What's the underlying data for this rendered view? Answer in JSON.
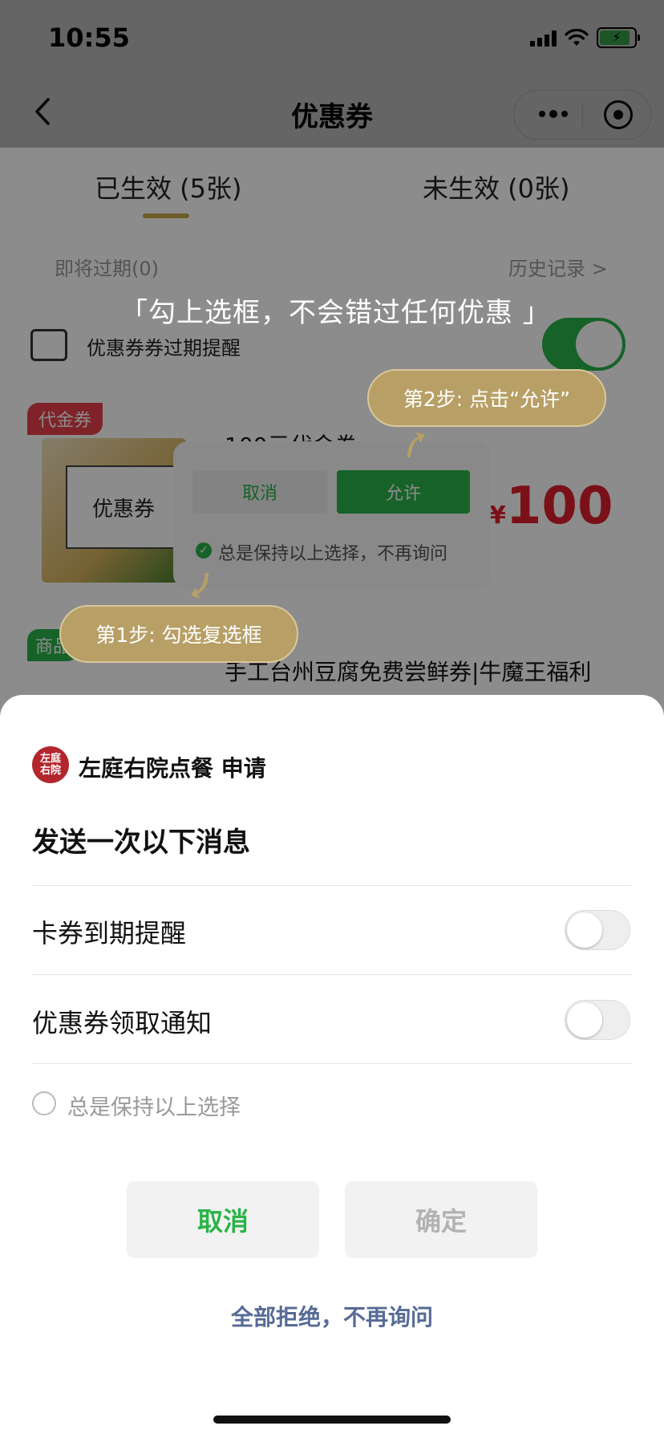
{
  "status_bar": {
    "time": "10:55"
  },
  "nav": {
    "title": "优惠券"
  },
  "tabs": [
    {
      "label": "已生效 (5张)"
    },
    {
      "label": "未生效 (0张)"
    }
  ],
  "meta": {
    "expiring": "即将过期(0)",
    "history": "历史记录 >"
  },
  "reminder": {
    "label": "优惠券券过期提醒"
  },
  "cards": [
    {
      "tag": "代金券",
      "image_text": "优惠券",
      "title": "100元代金券",
      "price_symbol": "¥",
      "price": "100"
    },
    {
      "tag": "商品",
      "title": "手工台州豆腐免费尝鲜券|牛魔王福利"
    }
  ],
  "demo_dialog": {
    "cancel": "取消",
    "allow": "允许",
    "keep": "总是保持以上选择，不再询问"
  },
  "tips": {
    "header": "「勾上选框，不会错过任何优惠 」",
    "step1": "第1步: 勾选复选框",
    "step2": "第2步: 点击“允许”"
  },
  "sheet": {
    "logo_text": [
      "左庭",
      "右院"
    ],
    "app_name": "左庭右院点餐  申请",
    "heading": "发送一次以下消息",
    "options": [
      {
        "label": "卡券到期提醒",
        "enabled": false
      },
      {
        "label": "优惠券领取通知",
        "enabled": false
      }
    ],
    "keep_label": "总是保持以上选择",
    "cancel_button": "取消",
    "confirm_button": "确定",
    "reject_all": "全部拒绝，不再询问"
  },
  "colors": {
    "accent": "#2bb34a",
    "link": "#576b95",
    "price": "#e0202d",
    "tip": "#b79f66"
  }
}
